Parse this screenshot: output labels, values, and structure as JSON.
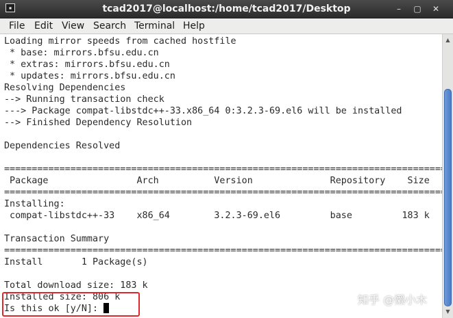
{
  "window": {
    "title": "tcad2017@localhost:/home/tcad2017/Desktop",
    "app_icon_glyph": "▪",
    "minimize_glyph": "–",
    "maximize_glyph": "▢",
    "close_glyph": "✕"
  },
  "menu": [
    "File",
    "Edit",
    "View",
    "Search",
    "Terminal",
    "Help"
  ],
  "terminal": {
    "output": "Loading mirror speeds from cached hostfile\n * base: mirrors.bfsu.edu.cn\n * extras: mirrors.bfsu.edu.cn\n * updates: mirrors.bfsu.edu.cn\nResolving Dependencies\n--> Running transaction check\n---> Package compat-libstdc++-33.x86_64 0:3.2.3-69.el6 will be installed\n--> Finished Dependency Resolution\n\nDependencies Resolved\n\n================================================================================\n Package                Arch          Version              Repository    Size\n================================================================================\nInstalling:\n compat-libstdc++-33    x86_64        3.2.3-69.el6         base         183 k\n\nTransaction Summary\n================================================================================\nInstall       1 Package(s)\n\nTotal download size: 183 k\nInstalled size: 806 k\nIs this ok [y/N]: "
  },
  "watermark": "知乎 @懒小木",
  "colors": {
    "titlebar": "#2b2b2b",
    "highlight": "#e0262d",
    "scroll_thumb": "#4a7cc8"
  }
}
